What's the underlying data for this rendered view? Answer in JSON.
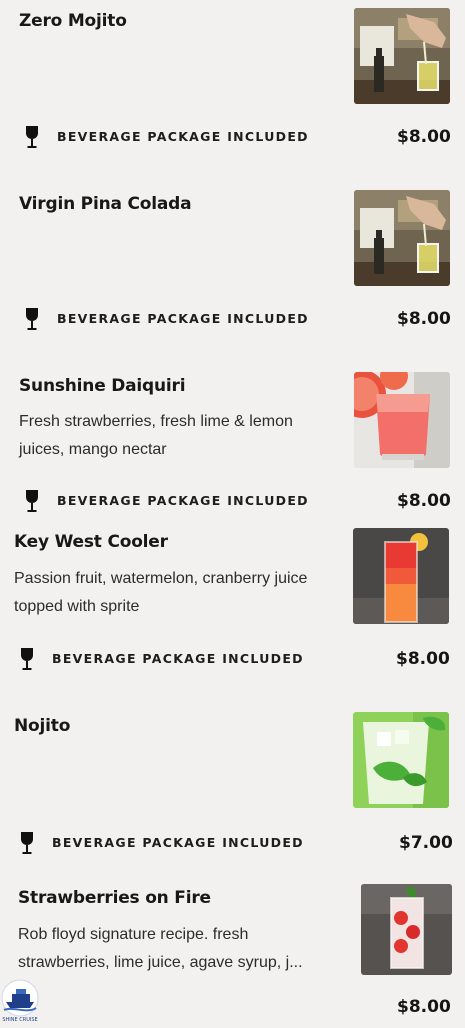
{
  "menu": {
    "items": [
      {
        "name": "Zero Mojito",
        "description": "",
        "package": "BEVERAGE PACKAGE INCLUDED",
        "price": "$8.00",
        "package_icon": "wine-glass-icon",
        "image": "bartender-pouring"
      },
      {
        "name": "Virgin Pina Colada",
        "description": "",
        "package": "BEVERAGE PACKAGE INCLUDED",
        "price": "$8.00",
        "package_icon": "wine-glass-icon",
        "image": "bartender-pouring"
      },
      {
        "name": "Sunshine Daiquiri",
        "description": "Fresh strawberries, fresh lime & lemon juices, mango nectar",
        "package": "BEVERAGE PACKAGE INCLUDED",
        "price": "$8.00",
        "package_icon": "wine-glass-icon",
        "image": "grapefruit-drink"
      },
      {
        "name": "Key West Cooler",
        "description": "Passion fruit, watermelon, cranberry juice topped with sprite",
        "package": "BEVERAGE PACKAGE INCLUDED",
        "price": "$8.00",
        "package_icon": "wine-glass-icon",
        "image": "tall-red-cooler"
      },
      {
        "name": "Nojito",
        "description": "",
        "package": "BEVERAGE PACKAGE INCLUDED",
        "price": "$7.00",
        "package_icon": "wine-glass-icon",
        "image": "mint-highball"
      },
      {
        "name": "Strawberries on Fire",
        "description": "Rob floyd signature recipe.  fresh strawberries, lime juice, agave syrup, j...",
        "package": "",
        "price": "$8.00",
        "package_icon": "",
        "image": "strawberry-highball"
      }
    ]
  },
  "watermark": {
    "text": "SHINE CRUISE"
  },
  "colors": {
    "background": "#f3f1ef",
    "text": "#181818"
  }
}
